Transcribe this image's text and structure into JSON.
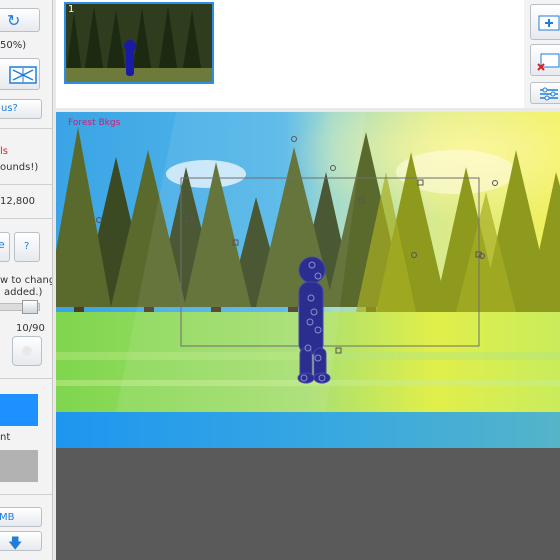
{
  "left_panel": {
    "refresh_icon": "refresh-icon",
    "zoom_text": "50%)",
    "flip_icon": "flip-horizontal-icon",
    "help_link_label": "us?",
    "warning_text": "ls",
    "warning_note": "ounds!)",
    "size_value": "12,800",
    "help_button_label": "?",
    "instruction_line1": "w to change",
    "instruction_line2": "added.)",
    "counter_text": "10/90",
    "color_label": "nt",
    "file_size_label": "MB",
    "download_icon": "arrow-down-icon"
  },
  "right_panel": {
    "add_frame_icon": "add-frame-icon",
    "delete_frame_icon": "delete-frame-icon",
    "settings_icon": "sliders-icon"
  },
  "frame_strip": {
    "frame_number": "1"
  },
  "canvas": {
    "scene_label": "Forest Bkgs"
  },
  "colors": {
    "accent_blue": "#1e90ff",
    "figure": "#2b2d8f",
    "sky": "#38b8f0",
    "grass": "#9ee05a",
    "gray_swatch": "#b2b2b2"
  }
}
